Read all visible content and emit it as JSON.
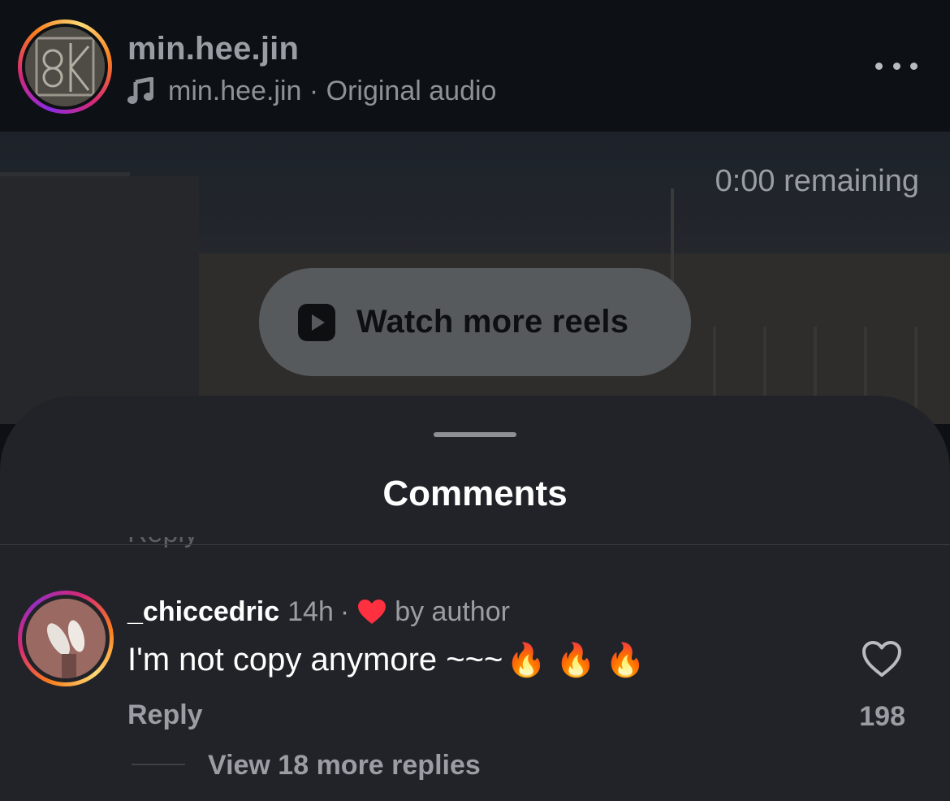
{
  "header": {
    "username": "min.hee.jin",
    "audio_owner": "min.hee.jin",
    "audio_separator": " · ",
    "audio_label": "Original audio",
    "avatar_icon": "profile-avatar",
    "audio_icon": "music-note-icon",
    "more_icon": "more-horizontal-icon"
  },
  "video": {
    "remaining": "0:00 remaining",
    "watch_more_label": "Watch more reels",
    "watch_more_icon": "reels-play-icon"
  },
  "comments": {
    "title": "Comments",
    "items": [
      {
        "username": "_chiccedric",
        "time": "14h",
        "separator": "·",
        "liked_by": "by author",
        "text": "I'm not copy anymore ~~~",
        "emoji": "🔥 🔥 🔥",
        "reply_label": "Reply",
        "like_count": "198",
        "view_replies": "View 18 more replies"
      }
    ]
  },
  "colors": {
    "background": "#0d1014",
    "sheet": "#212328",
    "muted_text": "#9a9da3",
    "heart_red": "#ff3040",
    "button_bg": "#575a5d"
  }
}
